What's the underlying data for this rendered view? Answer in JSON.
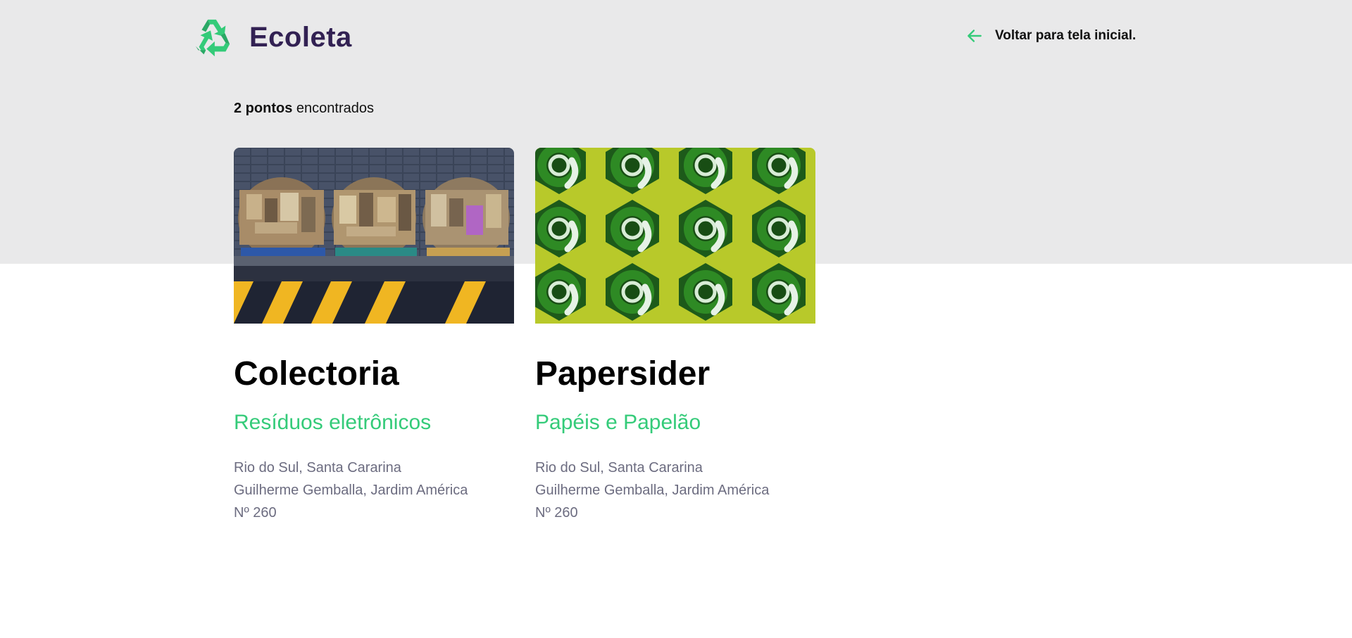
{
  "header": {
    "logo_text": "Ecoleta",
    "logo_icon": "recycle-icon",
    "back_icon": "arrow-left-icon",
    "back_label": "Voltar para tela inicial."
  },
  "results": {
    "count_bold": "2 pontos",
    "count_suffix": " encontrados"
  },
  "colors": {
    "brand_purple": "#322153",
    "accent_green": "#34cb79",
    "top_background": "#e9e9ea",
    "address_gray": "#6c6c80"
  },
  "points": [
    {
      "name": "Colectoria",
      "category": "Resíduos eletrônicos",
      "image_subject": "baled cardboard on pallets",
      "address_lines": [
        "Rio do Sul, Santa Cararina",
        "Guilherme Gemballa, Jardim América",
        "Nº 260"
      ]
    },
    {
      "name": "Papersider",
      "category": "Papéis e Papelão",
      "image_subject": "green glass bottles in hexagonal crate",
      "address_lines": [
        "Rio do Sul, Santa Cararina",
        "Guilherme Gemballa, Jardim América",
        "Nº 260"
      ]
    }
  ]
}
